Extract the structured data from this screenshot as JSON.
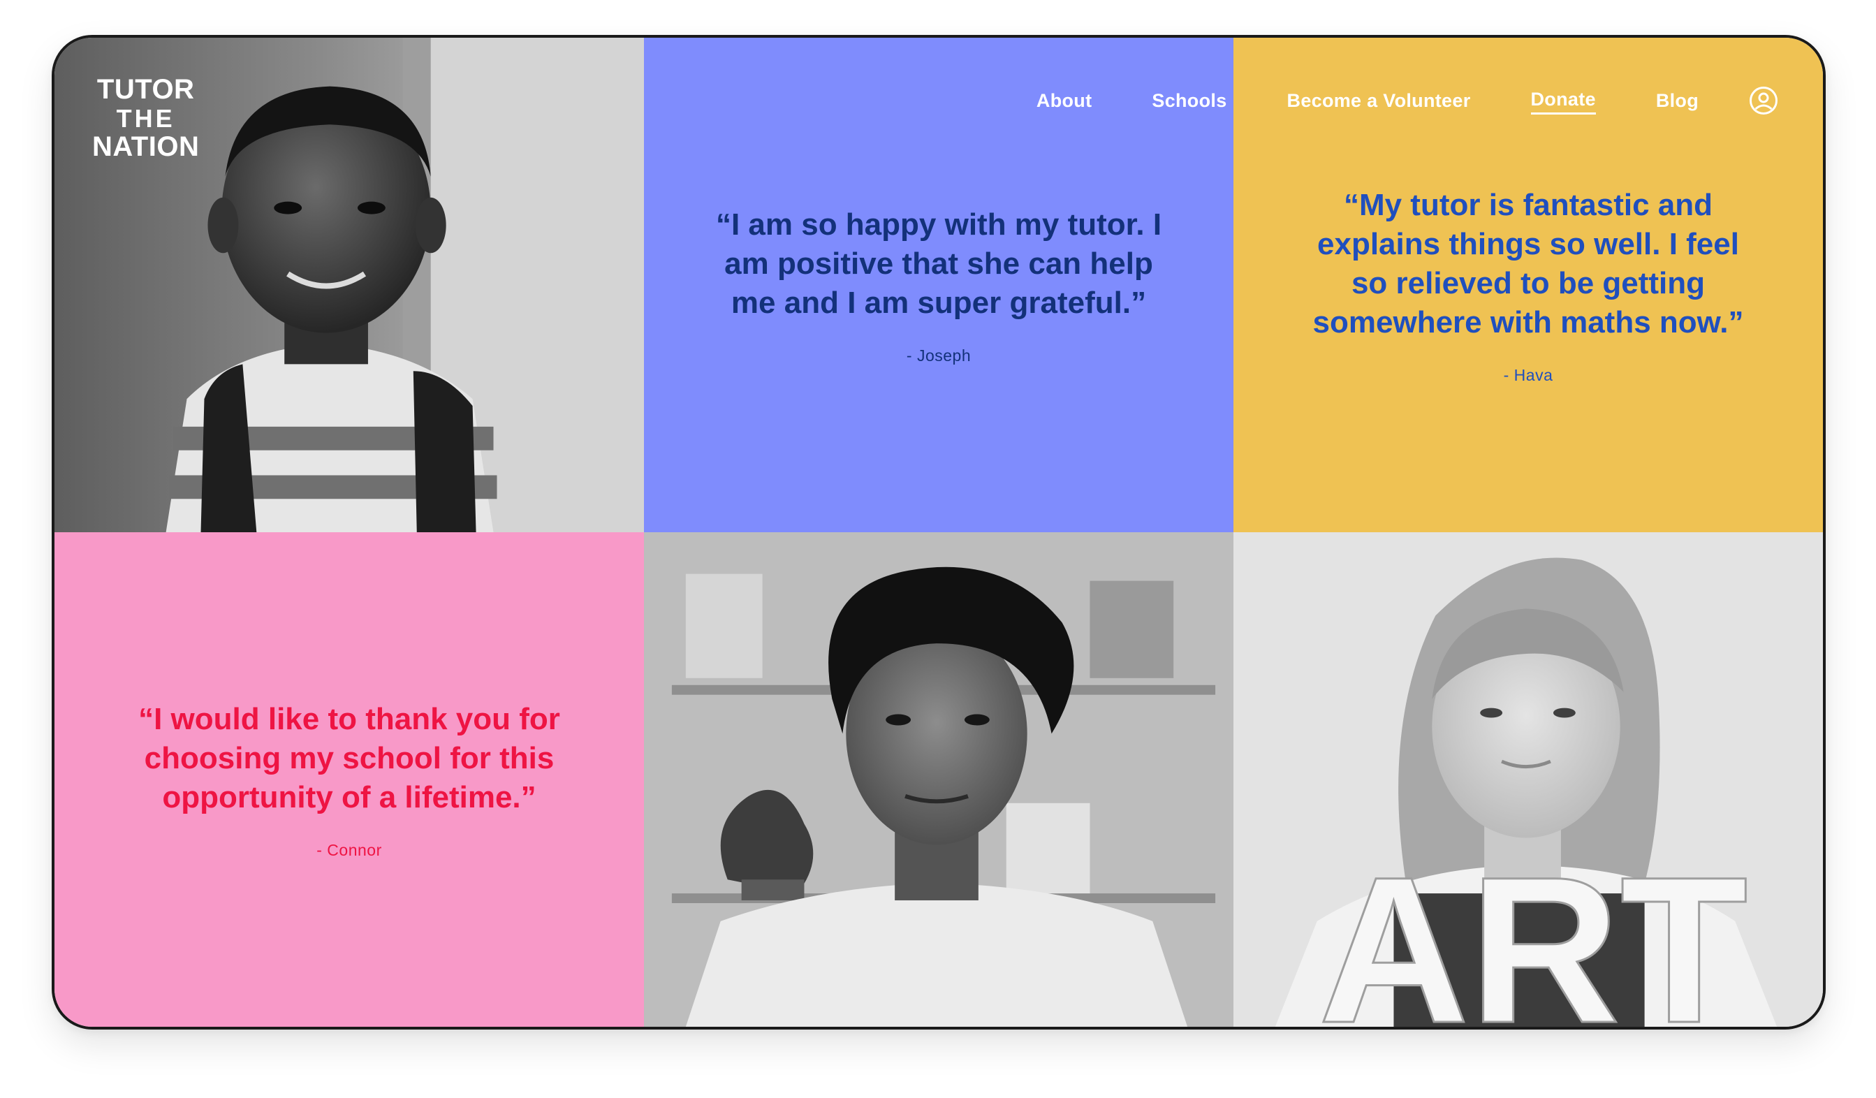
{
  "brand": {
    "line1": "TUTOR",
    "line2": "THE",
    "line3": "NATION"
  },
  "nav": {
    "items": [
      {
        "label": "About",
        "active": false
      },
      {
        "label": "Schools",
        "active": false
      },
      {
        "label": "Become a Volunteer",
        "active": false
      },
      {
        "label": "Donate",
        "active": true
      },
      {
        "label": "Blog",
        "active": false
      }
    ],
    "account_icon": "user-circle-icon"
  },
  "testimonials": [
    {
      "quote": "“I am so happy with my tutor. I am positive that she can help me and I am super grateful.”",
      "author": "- Joseph",
      "bg": "#7f8cfd",
      "text_color": "#13317a"
    },
    {
      "quote": "“My tutor is fantastic and explains things so well. I feel so relieved to be getting somewhere with maths now.”",
      "author": "- Hava",
      "bg": "#efc253",
      "text_color": "#1f4fbe"
    },
    {
      "quote": "“I would like to thank you for choosing my school for this opportunity of a lifetime.”",
      "author": "- Connor",
      "bg": "#f899c8",
      "text_color": "#ee1443"
    }
  ],
  "photos": {
    "photo1": "boy-with-backpack-photo",
    "photo2": "teen-boy-portrait-photo",
    "photo3": "girl-with-art-letters-photo",
    "art_letters": "ART"
  }
}
